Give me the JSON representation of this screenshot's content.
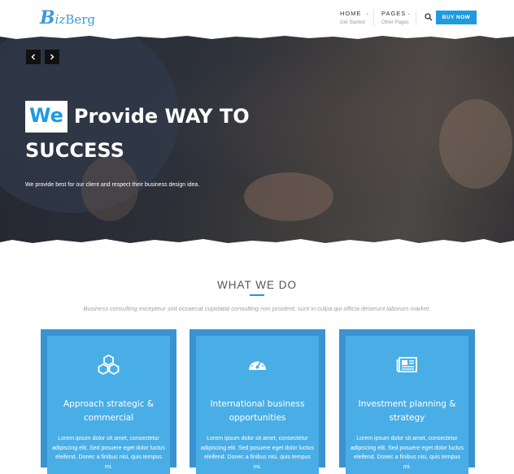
{
  "brand": {
    "logo_b": "B",
    "logo_iz": "iz",
    "logo_rest": "Berg"
  },
  "nav": {
    "items": [
      {
        "label": "HOME",
        "sub": "Get Started"
      },
      {
        "label": "PAGES",
        "sub": "Other Pages"
      }
    ],
    "buy_label": "BUY NOW"
  },
  "hero": {
    "highlight": "We",
    "title_line1": "Provide WAY TO",
    "title_line2": "SUCCESS",
    "subtitle": "We provide best for our client and respect their business design idea."
  },
  "section": {
    "title": "WHAT WE DO",
    "description": "Business consulting excepteur sint occaecat cupidatat consulting non proident, sunt in culpa qui officia deserunt laborum market."
  },
  "cards": [
    {
      "title_line1": "Approach strategic &",
      "title_line2": "commercial",
      "text": "Lorem ipsum dolor sit amet, consectetur adipiscing elit. Sed posuere eget dolor luctus eleifend. Donec a finibus nisi, quis tempus mi.",
      "icon": "cubes-icon"
    },
    {
      "title_line1": "International business",
      "title_line2": "opportunities",
      "text": "Lorem ipsum dolor sit amet, consectetur adipiscing elit. Sed posuere eget dolor luctus eleifend. Donec a finibus nisi, quis tempus mi.",
      "icon": "dashboard-icon"
    },
    {
      "title_line1": "Investment planning &",
      "title_line2": "strategy",
      "text": "Lorem ipsum dolor sit amet, consectetur adipiscing elit. Sed posuere eget dolor luctus eleifend. Donec a finibus nisi, quis tempus mi.",
      "icon": "newspaper-icon"
    }
  ],
  "colors": {
    "accent": "#1e9be0",
    "card_outer": "#3a93d0",
    "card_inner": "#4aaee6"
  }
}
